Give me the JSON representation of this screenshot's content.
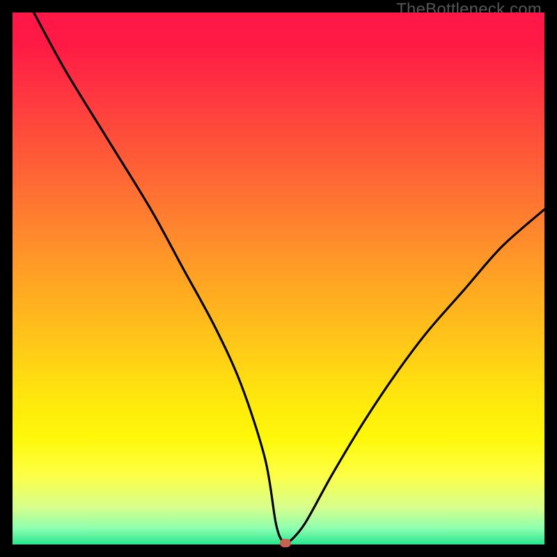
{
  "watermark": "TheBottleneck.com",
  "colors": {
    "frame": "#000000",
    "curve": "#000000",
    "marker": "#c76152"
  },
  "chart_data": {
    "type": "line",
    "title": "",
    "xlabel": "",
    "ylabel": "",
    "xlim": [
      0,
      100
    ],
    "ylim": [
      0,
      100
    ],
    "grid": false,
    "legend": false,
    "series": [
      {
        "name": "bottleneck-curve",
        "x": [
          4,
          10,
          18,
          26,
          32,
          38,
          43,
          47.5,
          49.5,
          50.8,
          52,
          55,
          60,
          66,
          72,
          78,
          85,
          92,
          100
        ],
        "y": [
          100,
          89,
          76,
          63,
          52,
          41,
          30,
          16,
          4,
          0.5,
          0.5,
          4,
          13,
          23,
          32,
          40,
          48,
          56,
          63
        ]
      }
    ],
    "annotations": [
      {
        "name": "optimal-marker",
        "x": 51.3,
        "y": 0.3
      }
    ],
    "background_gradient": [
      "#ff1748",
      "#ff3840",
      "#ff7d30",
      "#ffc718",
      "#fff80a",
      "#8dffb0",
      "#29e58f"
    ]
  }
}
